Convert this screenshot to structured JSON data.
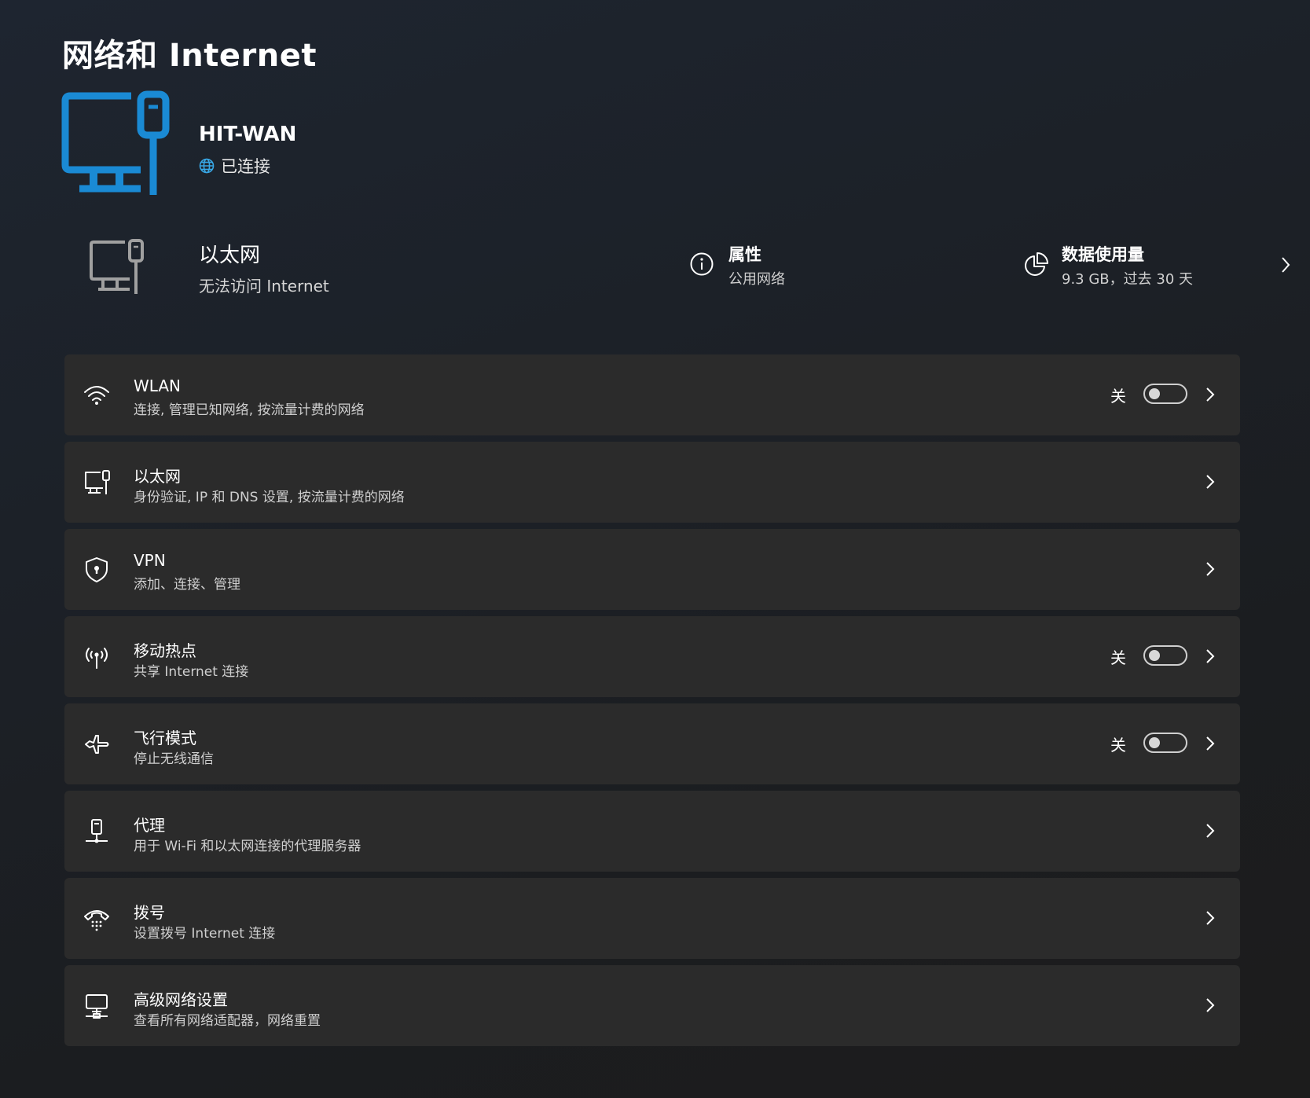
{
  "page": {
    "title": "网络和 Internet"
  },
  "hero": {
    "icon": "ethernet-monitor-icon",
    "name": "HIT-WAN",
    "status_icon": "globe-icon",
    "status": "已连接",
    "accent_color": "#1a8ad4"
  },
  "summary": {
    "icon": "ethernet-monitor-icon",
    "title": "以太网",
    "subtitle": "无法访问 Internet",
    "properties": {
      "icon": "info-icon",
      "title": "属性",
      "subtitle": "公用网络"
    },
    "data_usage": {
      "icon": "pie-chart-icon",
      "title": "数据使用量",
      "subtitle": "9.3 GB，过去 30 天"
    }
  },
  "settings": {
    "wlan": {
      "icon": "wifi-icon",
      "title": "WLAN",
      "subtitle": "连接, 管理已知网络, 按流量计费的网络",
      "toggle_label": "关",
      "toggle_on": false
    },
    "ethernet": {
      "icon": "ethernet-icon",
      "title": "以太网",
      "subtitle": "身份验证, IP 和 DNS 设置, 按流量计费的网络"
    },
    "vpn": {
      "icon": "shield-icon",
      "title": "VPN",
      "subtitle": "添加、连接、管理"
    },
    "hotspot": {
      "icon": "hotspot-icon",
      "title": "移动热点",
      "subtitle": "共享 Internet 连接",
      "toggle_label": "关",
      "toggle_on": false
    },
    "airplane": {
      "icon": "airplane-icon",
      "title": "飞行模式",
      "subtitle": "停止无线通信",
      "toggle_label": "关",
      "toggle_on": false
    },
    "proxy": {
      "icon": "proxy-icon",
      "title": "代理",
      "subtitle": "用于 Wi-Fi 和以太网连接的代理服务器"
    },
    "dialup": {
      "icon": "dialup-icon",
      "title": "拨号",
      "subtitle": "设置拨号 Internet 连接"
    },
    "advanced": {
      "icon": "advanced-network-icon",
      "title": "高级网络设置",
      "subtitle": "查看所有网络适配器，网络重置"
    }
  }
}
